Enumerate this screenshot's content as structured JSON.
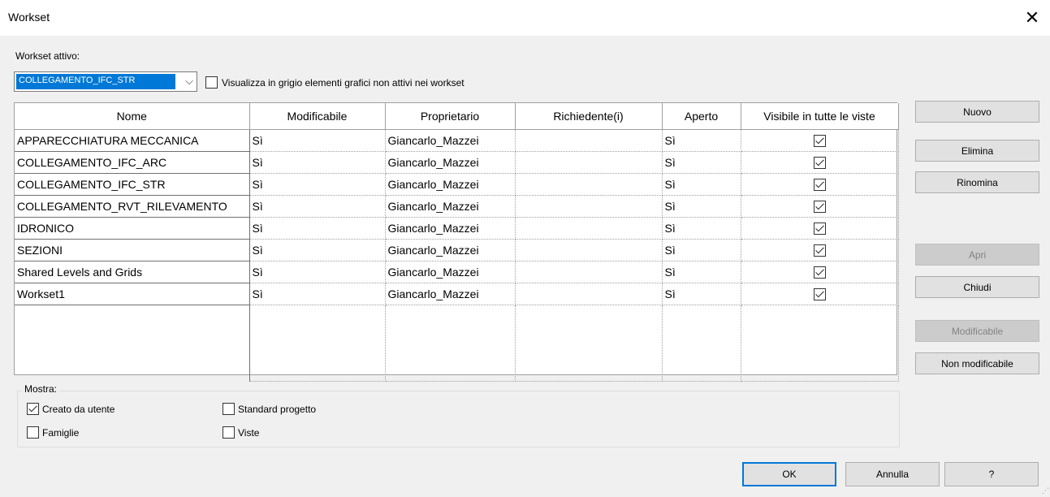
{
  "window": {
    "title": "Workset",
    "close_icon": "close-icon"
  },
  "active_workset": {
    "label": "Workset attivo:",
    "value": "COLLEGAMENTO_IFC_STR",
    "grey_option": {
      "label": "Visualizza in grigio elementi grafici non attivi nei workset",
      "checked": false
    }
  },
  "table": {
    "columns": [
      "Nome",
      "Modificabile",
      "Proprietario",
      "Richiedente(i)",
      "Aperto",
      "Visibile in tutte le viste"
    ],
    "rows": [
      {
        "name": "APPARECCHIATURA MECCANICA",
        "editable": "Sì",
        "owner": "Giancarlo_Mazzei",
        "borrowers": "",
        "open": "Sì",
        "visible": true
      },
      {
        "name": "COLLEGAMENTO_IFC_ARC",
        "editable": "Sì",
        "owner": "Giancarlo_Mazzei",
        "borrowers": "",
        "open": "Sì",
        "visible": true
      },
      {
        "name": "COLLEGAMENTO_IFC_STR",
        "editable": "Sì",
        "owner": "Giancarlo_Mazzei",
        "borrowers": "",
        "open": "Sì",
        "visible": true
      },
      {
        "name": "COLLEGAMENTO_RVT_RILEVAMENTO",
        "editable": "Sì",
        "owner": "Giancarlo_Mazzei",
        "borrowers": "",
        "open": "Sì",
        "visible": true
      },
      {
        "name": "IDRONICO",
        "editable": "Sì",
        "owner": "Giancarlo_Mazzei",
        "borrowers": "",
        "open": "Sì",
        "visible": true
      },
      {
        "name": "SEZIONI",
        "editable": "Sì",
        "owner": "Giancarlo_Mazzei",
        "borrowers": "",
        "open": "Sì",
        "visible": true
      },
      {
        "name": "Shared Levels and Grids",
        "editable": "Sì",
        "owner": "Giancarlo_Mazzei",
        "borrowers": "",
        "open": "Sì",
        "visible": true
      },
      {
        "name": "Workset1",
        "editable": "Sì",
        "owner": "Giancarlo_Mazzei",
        "borrowers": "",
        "open": "Sì",
        "visible": true
      }
    ]
  },
  "side_buttons": {
    "new": "Nuovo",
    "delete": "Elimina",
    "rename": "Rinomina",
    "open": "Apri",
    "close": "Chiudi",
    "editable": "Modificabile",
    "non_editable": "Non modificabile"
  },
  "show_group": {
    "title": "Mostra:",
    "options": {
      "user_created": {
        "label": "Creato da utente",
        "checked": true
      },
      "families": {
        "label": "Famiglie",
        "checked": false
      },
      "project_standards": {
        "label": "Standard progetto",
        "checked": false
      },
      "views": {
        "label": "Viste",
        "checked": false
      }
    }
  },
  "footer": {
    "ok": "OK",
    "cancel": "Annulla",
    "help": "?"
  }
}
